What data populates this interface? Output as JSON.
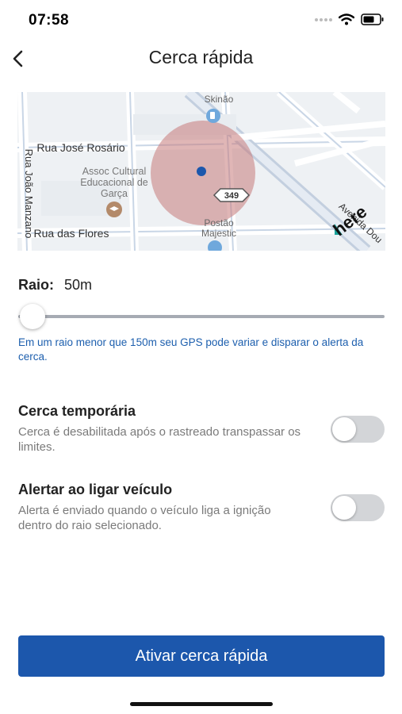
{
  "status_bar": {
    "time": "07:58"
  },
  "header": {
    "title": "Cerca rápida"
  },
  "map": {
    "streets": [
      "Rua José Rosário",
      "Rua João Manzano",
      "Rua das Flores",
      "Avenida Dou"
    ],
    "pois": [
      "Skinão",
      "Assoc Cultural",
      "Educacional de",
      "Garça",
      "Postão",
      "Majestic"
    ],
    "route_shield": "349",
    "attribution": "here",
    "geofence_color": "#c67a7a"
  },
  "radius": {
    "label": "Raio:",
    "value": "50m",
    "slider_fraction": 0.0
  },
  "hint": "Em um raio menor que 150m seu GPS pode variar e disparar o alerta da cerca.",
  "options": [
    {
      "title": "Cerca temporária",
      "description": "Cerca é desabilitada após o rastreado transpassar os limites.",
      "enabled": false
    },
    {
      "title": "Alertar ao ligar veículo",
      "description": "Alerta é enviado quando o veículo liga a ignição dentro do raio selecionado.",
      "enabled": false
    }
  ],
  "cta": {
    "label": "Ativar cerca rápida",
    "color": "#1c57ac"
  }
}
